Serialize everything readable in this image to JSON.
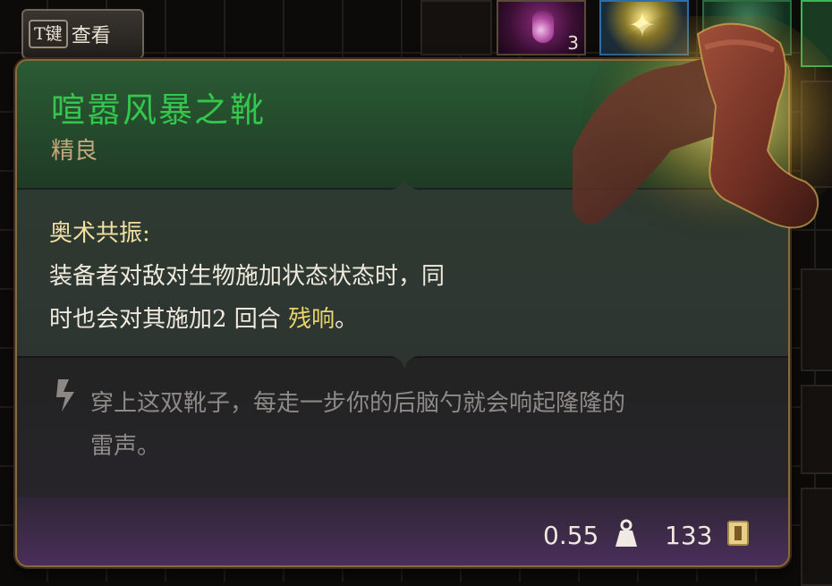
{
  "hint_button": {
    "key": "T键",
    "label": "查看"
  },
  "inventory": {
    "potion_count": "3"
  },
  "item": {
    "name": "喧嚣风暴之靴",
    "rarity": "精良",
    "effect_title": "奥术共振:",
    "effect_line1": "装备者对敌对生物施加状态状态时，同",
    "effect_line2_prefix": "时也会对其施加2 回合 ",
    "effect_line2_highlight": "残响",
    "effect_line2_suffix": "。",
    "flavor_line1": "穿上这双靴子，每走一步你的后脑勺就会响起隆隆的",
    "flavor_line2": "雷声。",
    "weight": "0.55",
    "value": "133"
  },
  "colors": {
    "name": "#35c64e",
    "rarity": "#c5a97c",
    "highlight": "#e8d46a",
    "border": "#8a6a3c"
  },
  "icons": [
    "weight-icon",
    "gold-icon",
    "flavor-quote-icon",
    "boots-item-icon"
  ]
}
